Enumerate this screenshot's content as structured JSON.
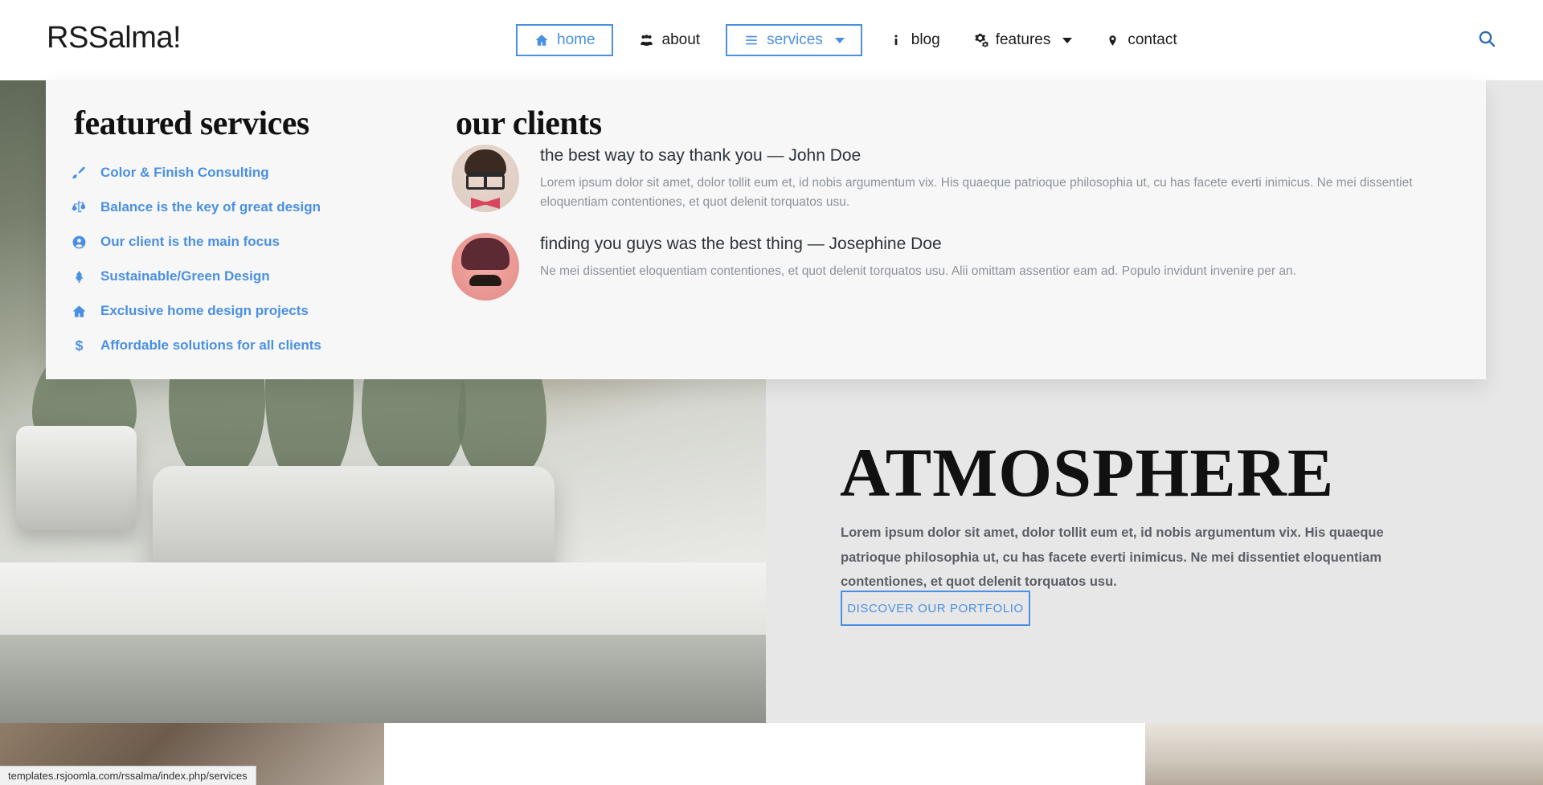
{
  "header": {
    "brand": "RSSalma!",
    "nav": [
      {
        "label": "home",
        "icon": "home-icon",
        "boxed": true,
        "caret": false
      },
      {
        "label": "about",
        "icon": "users-icon",
        "boxed": false,
        "caret": false
      },
      {
        "label": "services",
        "icon": "list-icon",
        "boxed": true,
        "caret": true
      },
      {
        "label": "blog",
        "icon": "info-icon",
        "boxed": false,
        "caret": false
      },
      {
        "label": "features",
        "icon": "gears-icon",
        "boxed": false,
        "caret": true
      },
      {
        "label": "contact",
        "icon": "location-icon",
        "boxed": false,
        "caret": false
      }
    ],
    "search_icon": "search-icon"
  },
  "mega_menu": {
    "services": {
      "title": "featured services",
      "items": [
        {
          "label": "Color & Finish Consulting",
          "icon": "paintbrush-icon"
        },
        {
          "label": "Balance is the key of great design",
          "icon": "balance-scale-icon"
        },
        {
          "label": "Our client is the main focus",
          "icon": "user-circle-icon"
        },
        {
          "label": "Sustainable/Green Design",
          "icon": "tree-icon"
        },
        {
          "label": "Exclusive home design projects",
          "icon": "home-icon"
        },
        {
          "label": "Affordable solutions for all clients",
          "icon": "dollar-icon"
        }
      ]
    },
    "clients": {
      "title": "our clients",
      "items": [
        {
          "title": "the best way to say thank you — John Doe",
          "text": "Lorem ipsum dolor sit amet, dolor tollit eum et, id nobis argumentum vix. His quaeque patrioque philosophia ut, cu has facete everti inimicus. Ne mei dissentiet eloquentiam contentiones, et quot delenit torquatos usu.",
          "avatar": "avatar-john-doe"
        },
        {
          "title": "finding you guys was the best thing — Josephine Doe",
          "text": "Ne mei dissentiet eloquentiam contentiones, et quot delenit torquatos usu. Alii omittam assentior eam ad. Populo invidunt invenire per an.",
          "avatar": "avatar-josephine-doe"
        }
      ]
    }
  },
  "hero": {
    "title": "ATMOSPHERE",
    "paragraph": "Lorem ipsum dolor sit amet, dolor tollit eum et, id nobis argumentum vix. His quaeque patrioque philosophia ut, cu has facete everti inimicus. Ne mei dissentiet eloquentiam contentiones, et quot delenit torquatos usu.",
    "cta_label": "DISCOVER OUR PORTFOLIO"
  },
  "status_bar": {
    "url": "templates.rsjoomla.com/rssalma/index.php/services"
  },
  "colors": {
    "accent": "#4a90e2",
    "text_dark": "#1c1c1c",
    "muted": "#8c9299",
    "panel_bg": "#f7f7f7"
  }
}
